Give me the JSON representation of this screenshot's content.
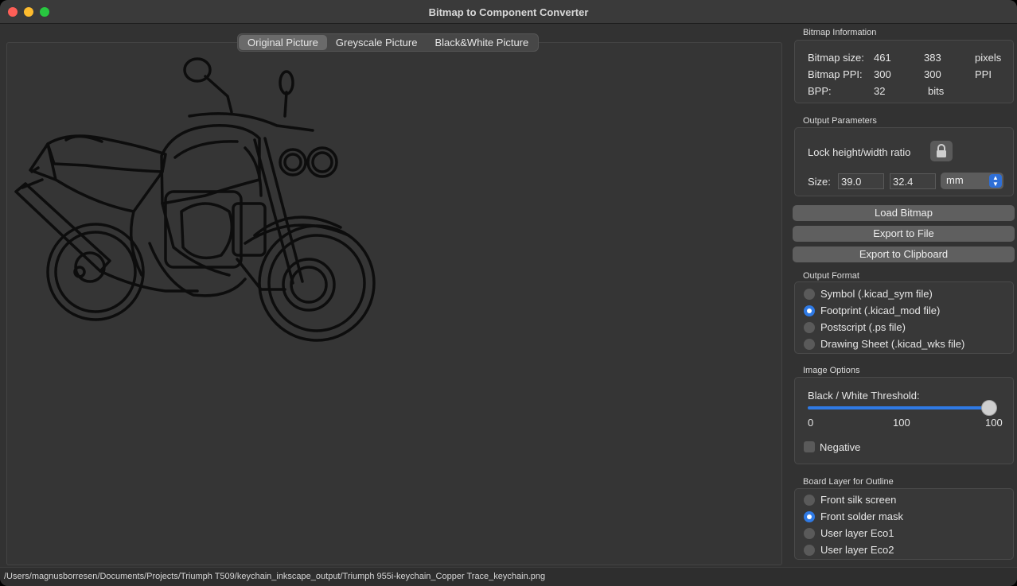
{
  "window": {
    "title": "Bitmap to Component Converter"
  },
  "tabs": [
    "Original Picture",
    "Greyscale Picture",
    "Black&White Picture"
  ],
  "active_tab": "Original Picture",
  "bitmap_info": {
    "label": "Bitmap Information",
    "size_label": "Bitmap size:",
    "size_w": "461",
    "size_h": "383",
    "size_unit": "pixels",
    "ppi_label": "Bitmap PPI:",
    "ppi_x": "300",
    "ppi_y": "300",
    "ppi_unit": "PPI",
    "bpp_label": "BPP:",
    "bpp_value": "32",
    "bpp_unit": "bits"
  },
  "output_params": {
    "label": "Output Parameters",
    "lock_label": "Lock height/width ratio",
    "size_label": "Size:",
    "width": "39.0",
    "height": "32.4",
    "unit": "mm"
  },
  "buttons": {
    "load": "Load Bitmap",
    "export_file": "Export to File",
    "export_clipboard": "Export to Clipboard"
  },
  "output_format": {
    "label": "Output Format",
    "options": [
      "Symbol (.kicad_sym file)",
      "Footprint (.kicad_mod file)",
      "Postscript (.ps file)",
      "Drawing Sheet (.kicad_wks file)"
    ],
    "selected": "Footprint (.kicad_mod file)"
  },
  "image_options": {
    "label": "Image Options",
    "threshold_label": "Black / White Threshold:",
    "threshold_value": 100,
    "tick_min": "0",
    "tick_mid": "100",
    "tick_max": "100",
    "negative_label": "Negative",
    "negative_checked": false
  },
  "board_layer": {
    "label": "Board Layer for Outline",
    "options": [
      "Front silk screen",
      "Front solder mask",
      "User layer Eco1",
      "User layer Eco2"
    ],
    "selected": "Front solder mask"
  },
  "status": {
    "path": "/Users/magnusborresen/Documents/Projects/Triumph T509/keychain_inkscape_output/Triumph 955i-keychain_Copper Trace_keychain.png"
  },
  "colors": {
    "accent": "#2f7ae5",
    "window_bg": "#323232",
    "panel_bg": "#383838"
  }
}
